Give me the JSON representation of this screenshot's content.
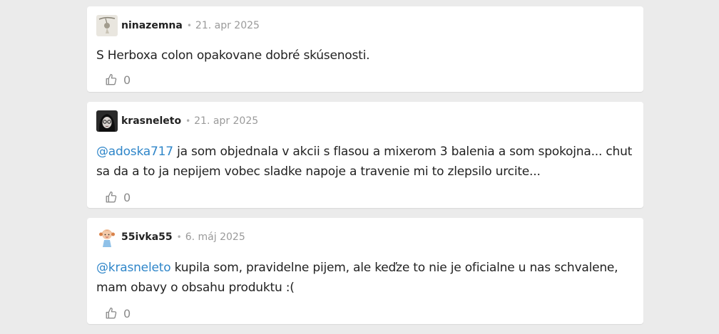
{
  "comments": [
    {
      "username": "ninazemna",
      "separator": "•",
      "date": "21. apr 2025",
      "mention": "",
      "text": "S Herboxa colon opakovane dobré skúsenosti.",
      "likes": "0",
      "avatar_icon": "avatar-pendant-photo"
    },
    {
      "username": "krasneleto",
      "separator": "•",
      "date": "21. apr 2025",
      "mention": "@adoska717",
      "text": " ja som objednala v akcii s flasou a mixerom 3 balenia a som spokojna... chut sa da a to ja nepijem vobec sladke napoje a travenie mi to zlepsilo urcite...",
      "likes": "0",
      "avatar_icon": "avatar-woman-glasses-photo"
    },
    {
      "username": "55ivka55",
      "separator": "•",
      "date": "6. máj 2025",
      "mention": "@krasneleto",
      "text": " kupila som, pravidelne pijem, ale keďze to nie je oficialne u nas schvalene, mam obavy o obsahu produktu :(",
      "likes": "0",
      "avatar_icon": "avatar-girl-cartoon"
    }
  ],
  "colors": {
    "background": "#ebebeb",
    "card": "#ffffff",
    "mention": "#2f86c9",
    "muted": "#9a9a9a"
  },
  "icons": {
    "like": "thumbs-up-icon"
  }
}
